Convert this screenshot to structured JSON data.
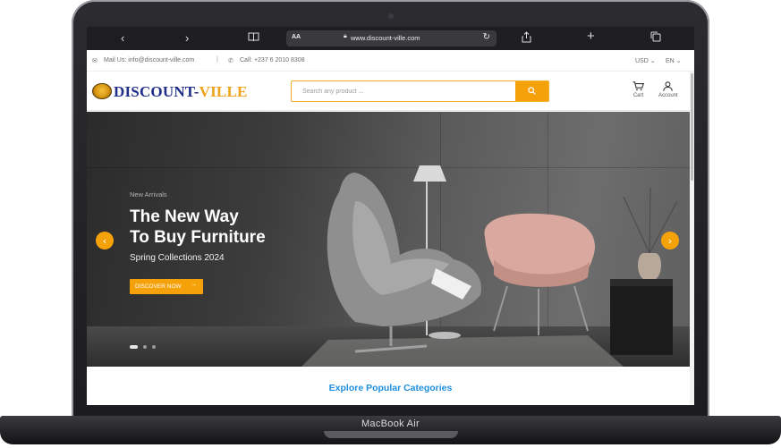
{
  "device": {
    "label": "MacBook Air"
  },
  "browser": {
    "url": "www.discount-ville.com",
    "text_size_label": "AA"
  },
  "topbar": {
    "mail": "Mail Us: info@discount-ville.com",
    "separator": "|",
    "call": "Call: +237 6 2010 8308",
    "currency": "USD",
    "language": "EN"
  },
  "header": {
    "logo_main": "DISCOUNT-",
    "logo_accent": "VILLE",
    "search_placeholder": "Search any product ...",
    "cart_label": "Cart",
    "account_label": "Account"
  },
  "hero": {
    "kicker": "New Arrivals",
    "title_line1": "The New Way",
    "title_line2": "To Buy Furniture",
    "subtitle": "Spring Collections 2024",
    "cta_label": "DISCOVER NOW",
    "active_slide": 1,
    "slide_count": 3
  },
  "categories": {
    "title": "Explore Popular Categories"
  },
  "colors": {
    "accent": "#f5a20a",
    "link": "#1e8fe0",
    "logo_blue": "#1f2f8a"
  }
}
